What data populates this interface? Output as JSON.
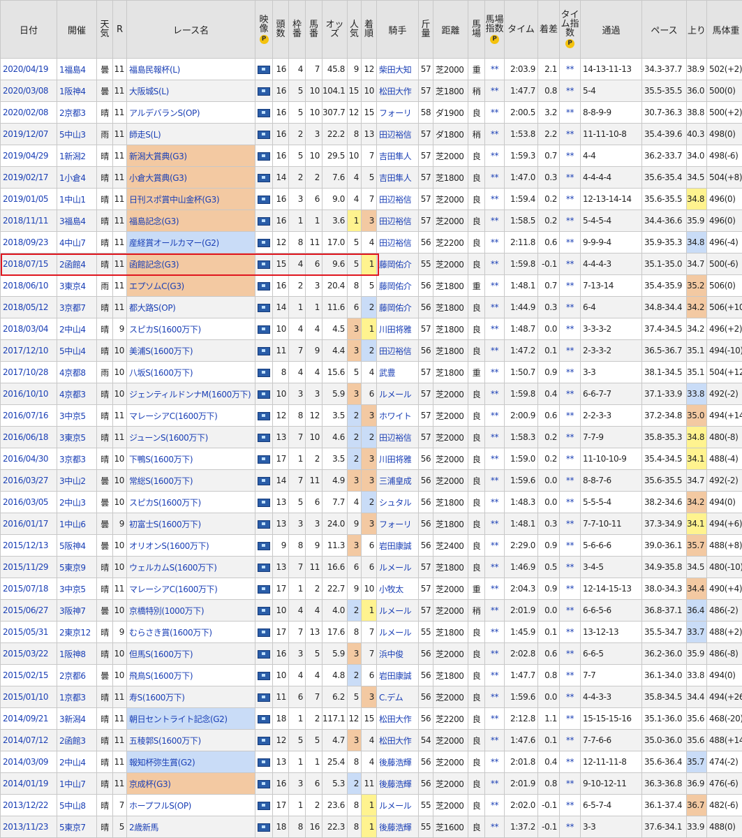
{
  "headers": {
    "date": "日付",
    "kaisai": "開催",
    "weather": "天気",
    "r": "R",
    "race_name": "レース名",
    "video": "映像",
    "heads": "頭数",
    "waku": "枠番",
    "uma": "馬番",
    "odds": "オッズ",
    "ninki": "人気",
    "chakujun": "着順",
    "jockey": "騎手",
    "kinryo": "斤量",
    "distance": "距離",
    "baba": "馬場",
    "baba_index": "馬場指数",
    "time": "タイム",
    "chakusa": "着差",
    "time_index": "タイム指数",
    "tsuka": "通過",
    "pace": "ペース",
    "agari": "上り",
    "weight": "馬体重",
    "p_badge": "P"
  },
  "colors": {
    "g3": "#f3c9a2",
    "g2": "#c9dcf7",
    "pick1": "#fff38f",
    "link": "#1a3fb5",
    "highlight": "#e0161f"
  },
  "rows": [
    [
      "2020/04/19",
      "1福島4",
      "曇",
      "11",
      "福島民報杯(L)",
      "",
      "16",
      "4",
      "7",
      "45.8",
      "9",
      "12",
      "柴田大知",
      "57",
      "芝2000",
      "重",
      "**",
      "2:03.9",
      "2.1",
      "**",
      "14-13-11-13",
      "34.3-37.7",
      "38.9",
      "502(+2)"
    ],
    [
      "2020/03/08",
      "1阪神4",
      "曇",
      "11",
      "大阪城S(L)",
      "",
      "16",
      "5",
      "10",
      "104.1",
      "15",
      "10",
      "松田大作",
      "57",
      "芝1800",
      "稍",
      "**",
      "1:47.7",
      "0.8",
      "**",
      "5-4",
      "35.5-35.5",
      "36.0",
      "500(0)"
    ],
    [
      "2020/02/08",
      "2京都3",
      "晴",
      "11",
      "アルデバランS(OP)",
      "",
      "16",
      "5",
      "10",
      "307.7",
      "12",
      "15",
      "フォーリ",
      "58",
      "ダ1900",
      "良",
      "**",
      "2:00.5",
      "3.2",
      "**",
      "8-8-9-9",
      "30.7-36.3",
      "38.8",
      "500(+2)"
    ],
    [
      "2019/12/07",
      "5中山3",
      "雨",
      "11",
      "師走S(L)",
      "",
      "16",
      "2",
      "3",
      "22.2",
      "8",
      "13",
      "田辺裕信",
      "57",
      "ダ1800",
      "稍",
      "**",
      "1:53.8",
      "2.2",
      "**",
      "11-11-10-8",
      "35.4-39.6",
      "40.3",
      "498(0)"
    ],
    [
      "2019/04/29",
      "1新潟2",
      "晴",
      "11",
      "新潟大賞典(G3)",
      "g3",
      "16",
      "5",
      "10",
      "29.5",
      "10",
      "7",
      "吉田隼人",
      "57",
      "芝2000",
      "良",
      "**",
      "1:59.3",
      "0.7",
      "**",
      "4-4",
      "36.2-33.7",
      "34.0",
      "498(-6)"
    ],
    [
      "2019/02/17",
      "1小倉4",
      "晴",
      "11",
      "小倉大賞典(G3)",
      "g3",
      "14",
      "2",
      "2",
      "7.6",
      "4",
      "5",
      "吉田隼人",
      "57",
      "芝1800",
      "良",
      "**",
      "1:47.0",
      "0.3",
      "**",
      "4-4-4-4",
      "35.6-35.4",
      "34.5",
      "504(+8)"
    ],
    [
      "2019/01/05",
      "1中山1",
      "晴",
      "11",
      "日刊スポ賞中山金杯(G3)",
      "g3",
      "16",
      "3",
      "6",
      "9.0",
      "4",
      "7",
      "田辺裕信",
      "57",
      "芝2000",
      "良",
      "**",
      "1:59.4",
      "0.2",
      "**",
      "12-13-14-14",
      "35.6-35.5",
      "34.8",
      "496(0)"
    ],
    [
      "2018/11/11",
      "3福島4",
      "晴",
      "11",
      "福島記念(G3)",
      "g3",
      "16",
      "1",
      "1",
      "3.6",
      "1",
      "3",
      "田辺裕信",
      "57",
      "芝2000",
      "良",
      "**",
      "1:58.5",
      "0.2",
      "**",
      "5-4-5-4",
      "34.4-36.6",
      "35.9",
      "496(0)"
    ],
    [
      "2018/09/23",
      "4中山7",
      "晴",
      "11",
      "産経賞オールカマー(G2)",
      "g2",
      "12",
      "8",
      "11",
      "17.0",
      "5",
      "4",
      "田辺裕信",
      "56",
      "芝2200",
      "良",
      "**",
      "2:11.8",
      "0.6",
      "**",
      "9-9-9-4",
      "35.9-35.3",
      "34.8",
      "496(-4)"
    ],
    [
      "2018/07/15",
      "2函館4",
      "晴",
      "11",
      "函館記念(G3)",
      "g3",
      "15",
      "4",
      "6",
      "9.6",
      "5",
      "1",
      "藤岡佑介",
      "55",
      "芝2000",
      "良",
      "**",
      "1:59.8",
      "-0.1",
      "**",
      "4-4-4-3",
      "35.1-35.0",
      "34.7",
      "500(-6)"
    ],
    [
      "2018/06/10",
      "3東京4",
      "雨",
      "11",
      "エプソムC(G3)",
      "g3",
      "16",
      "2",
      "3",
      "20.4",
      "8",
      "5",
      "藤岡佑介",
      "56",
      "芝1800",
      "重",
      "**",
      "1:48.1",
      "0.7",
      "**",
      "7-13-14",
      "35.4-35.9",
      "35.2",
      "506(0)"
    ],
    [
      "2018/05/12",
      "3京都7",
      "晴",
      "11",
      "都大路S(OP)",
      "",
      "14",
      "1",
      "1",
      "11.6",
      "6",
      "2",
      "藤岡佑介",
      "56",
      "芝1800",
      "良",
      "**",
      "1:44.9",
      "0.3",
      "**",
      "6-4",
      "34.8-34.4",
      "34.2",
      "506(+10)"
    ],
    [
      "2018/03/04",
      "2中山4",
      "晴",
      "9",
      "スピカS(1600万下)",
      "",
      "10",
      "4",
      "4",
      "4.5",
      "3",
      "1",
      "川田将雅",
      "57",
      "芝1800",
      "良",
      "**",
      "1:48.7",
      "0.0",
      "**",
      "3-3-3-2",
      "37.4-34.5",
      "34.2",
      "496(+2)"
    ],
    [
      "2017/12/10",
      "5中山4",
      "晴",
      "10",
      "美浦S(1600万下)",
      "",
      "11",
      "7",
      "9",
      "4.4",
      "3",
      "2",
      "田辺裕信",
      "56",
      "芝1800",
      "良",
      "**",
      "1:47.2",
      "0.1",
      "**",
      "2-3-3-2",
      "36.5-36.7",
      "35.1",
      "494(-10)"
    ],
    [
      "2017/10/28",
      "4京都8",
      "雨",
      "10",
      "八坂S(1600万下)",
      "",
      "8",
      "4",
      "4",
      "15.6",
      "5",
      "4",
      "武豊",
      "57",
      "芝1800",
      "重",
      "**",
      "1:50.7",
      "0.9",
      "**",
      "3-3",
      "38.1-34.5",
      "35.1",
      "504(+12)"
    ],
    [
      "2016/10/10",
      "4京都3",
      "晴",
      "10",
      "ジェンティルドンナM(1600万下)",
      "",
      "10",
      "3",
      "3",
      "5.9",
      "3",
      "6",
      "ルメール",
      "57",
      "芝2000",
      "良",
      "**",
      "1:59.8",
      "0.4",
      "**",
      "6-6-7-7",
      "37.1-33.9",
      "33.8",
      "492(-2)"
    ],
    [
      "2016/07/16",
      "3中京5",
      "晴",
      "11",
      "マレーシアC(1600万下)",
      "",
      "12",
      "8",
      "12",
      "3.5",
      "2",
      "3",
      "ホワイト",
      "57",
      "芝2000",
      "良",
      "**",
      "2:00.9",
      "0.6",
      "**",
      "2-2-3-3",
      "37.2-34.8",
      "35.0",
      "494(+14)"
    ],
    [
      "2016/06/18",
      "3東京5",
      "晴",
      "11",
      "ジューンS(1600万下)",
      "",
      "13",
      "7",
      "10",
      "4.6",
      "2",
      "2",
      "田辺裕信",
      "57",
      "芝2000",
      "良",
      "**",
      "1:58.3",
      "0.2",
      "**",
      "7-7-9",
      "35.8-35.3",
      "34.8",
      "480(-8)"
    ],
    [
      "2016/04/30",
      "3京都3",
      "晴",
      "10",
      "下鴨S(1600万下)",
      "",
      "17",
      "1",
      "2",
      "3.5",
      "2",
      "3",
      "川田将雅",
      "56",
      "芝2000",
      "良",
      "**",
      "1:59.0",
      "0.2",
      "**",
      "11-10-10-9",
      "35.4-34.5",
      "34.1",
      "488(-4)"
    ],
    [
      "2016/03/27",
      "3中山2",
      "曇",
      "10",
      "常総S(1600万下)",
      "",
      "14",
      "7",
      "11",
      "4.9",
      "3",
      "3",
      "三浦皇成",
      "56",
      "芝2000",
      "良",
      "**",
      "1:59.6",
      "0.0",
      "**",
      "8-8-7-6",
      "35.6-35.5",
      "34.7",
      "492(-2)"
    ],
    [
      "2016/03/05",
      "2中山3",
      "曇",
      "10",
      "スピカS(1600万下)",
      "",
      "13",
      "5",
      "6",
      "7.7",
      "4",
      "2",
      "シュタル",
      "56",
      "芝1800",
      "良",
      "**",
      "1:48.3",
      "0.0",
      "**",
      "5-5-5-4",
      "38.2-34.6",
      "34.2",
      "494(0)"
    ],
    [
      "2016/01/17",
      "1中山6",
      "曇",
      "9",
      "初富士S(1600万下)",
      "",
      "13",
      "3",
      "24.0",
      "9",
      "3",
      "",
      "フォーリ",
      "56",
      "芝1800",
      "良",
      "**",
      "1:48.1",
      "0.3",
      "**",
      "7-7-10-11",
      "37.3-34.9",
      "34.1",
      "494(+6)"
    ],
    [
      "2015/12/13",
      "5阪神4",
      "曇",
      "10",
      "オリオンS(1600万下)",
      "",
      "9",
      "8",
      "9",
      "11.3",
      "3",
      "6",
      "岩田康誠",
      "56",
      "芝2400",
      "良",
      "**",
      "2:29.0",
      "0.9",
      "**",
      "5-6-6-6",
      "39.0-36.1",
      "35.7",
      "488(+8)"
    ],
    [
      "2015/11/29",
      "5東京9",
      "晴",
      "10",
      "ウェルカムS(1600万下)",
      "",
      "13",
      "7",
      "11",
      "16.6",
      "6",
      "6",
      "ルメール",
      "57",
      "芝1800",
      "良",
      "**",
      "1:46.9",
      "0.5",
      "**",
      "3-4-5",
      "34.9-35.8",
      "34.5",
      "480(-10)"
    ],
    [
      "2015/07/18",
      "3中京5",
      "晴",
      "11",
      "マレーシアC(1600万下)",
      "",
      "17",
      "1",
      "2",
      "22.7",
      "9",
      "10",
      "小牧太",
      "57",
      "芝2000",
      "重",
      "**",
      "2:04.3",
      "0.9",
      "**",
      "12-14-15-13",
      "38.0-34.3",
      "34.4",
      "490(+4)"
    ],
    [
      "2015/06/27",
      "3阪神7",
      "曇",
      "10",
      "京橋特別(1000万下)",
      "",
      "10",
      "4",
      "4",
      "4.0",
      "2",
      "1",
      "ルメール",
      "57",
      "芝2000",
      "稍",
      "**",
      "2:01.9",
      "0.0",
      "**",
      "6-6-5-6",
      "36.8-37.1",
      "36.4",
      "486(-2)"
    ],
    [
      "2015/05/31",
      "2東京12",
      "晴",
      "9",
      "むらさき賞(1600万下)",
      "",
      "17",
      "7",
      "13",
      "17.6",
      "8",
      "7",
      "ルメール",
      "55",
      "芝1800",
      "良",
      "**",
      "1:45.9",
      "0.1",
      "**",
      "13-12-13",
      "35.5-34.7",
      "33.7",
      "488(+2)"
    ],
    [
      "2015/03/22",
      "1阪神8",
      "晴",
      "10",
      "但馬S(1600万下)",
      "",
      "16",
      "3",
      "5",
      "5.9",
      "3",
      "7",
      "浜中俊",
      "56",
      "芝2000",
      "良",
      "**",
      "2:02.8",
      "0.6",
      "**",
      "6-6-5",
      "36.2-36.0",
      "35.9",
      "486(-8)"
    ],
    [
      "2015/02/15",
      "2京都6",
      "曇",
      "10",
      "飛鳥S(1600万下)",
      "",
      "10",
      "4",
      "4",
      "4.8",
      "2",
      "6",
      "岩田康誠",
      "56",
      "芝1800",
      "良",
      "**",
      "1:47.7",
      "0.8",
      "**",
      "7-7",
      "36.1-34.0",
      "33.8",
      "494(0)"
    ],
    [
      "2015/01/10",
      "1京都3",
      "晴",
      "11",
      "寿S(1600万下)",
      "",
      "11",
      "6",
      "7",
      "6.2",
      "5",
      "3",
      "C.デム",
      "56",
      "芝2000",
      "良",
      "**",
      "1:59.6",
      "0.0",
      "**",
      "4-4-3-3",
      "35.8-34.5",
      "34.4",
      "494(+26)"
    ],
    [
      "2014/09/21",
      "3新潟4",
      "晴",
      "11",
      "朝日セントライト記念(G2)",
      "g2",
      "18",
      "1",
      "2",
      "117.1",
      "12",
      "15",
      "松田大作",
      "56",
      "芝2200",
      "良",
      "**",
      "2:12.8",
      "1.1",
      "**",
      "15-15-15-16",
      "35.1-36.0",
      "35.6",
      "468(-20)"
    ],
    [
      "2014/07/12",
      "2函館3",
      "晴",
      "11",
      "五稜郭S(1600万下)",
      "",
      "12",
      "5",
      "5",
      "4.7",
      "3",
      "4",
      "松田大作",
      "54",
      "芝2000",
      "良",
      "**",
      "1:47.6",
      "0.1",
      "**",
      "7-7-6-6",
      "35.0-36.0",
      "35.6",
      "488(+14)"
    ],
    [
      "2014/03/09",
      "2中山4",
      "晴",
      "11",
      "報知杯弥生賞(G2)",
      "g2",
      "13",
      "1",
      "1",
      "25.4",
      "8",
      "4",
      "後藤浩輝",
      "56",
      "芝2000",
      "良",
      "**",
      "2:01.8",
      "0.4",
      "**",
      "12-11-11-8",
      "35.6-36.4",
      "35.7",
      "474(-2)"
    ],
    [
      "2014/01/19",
      "1中山7",
      "晴",
      "11",
      "京成杯(G3)",
      "g3",
      "16",
      "3",
      "6",
      "5.3",
      "2",
      "11",
      "後藤浩輝",
      "56",
      "芝2000",
      "良",
      "**",
      "2:01.9",
      "0.8",
      "**",
      "9-10-12-11",
      "36.3-36.8",
      "36.9",
      "476(-6)"
    ],
    [
      "2013/12/22",
      "5中山8",
      "晴",
      "7",
      "ホープフルS(OP)",
      "",
      "17",
      "1",
      "2",
      "23.6",
      "8",
      "1",
      "ルメール",
      "55",
      "芝2000",
      "良",
      "**",
      "2:02.0",
      "-0.1",
      "**",
      "6-5-7-4",
      "36.1-37.4",
      "36.7",
      "482(-6)"
    ],
    [
      "2013/11/23",
      "5東京7",
      "晴",
      "5",
      "2歳新馬",
      "",
      "18",
      "8",
      "16",
      "22.3",
      "8",
      "1",
      "後藤浩輝",
      "55",
      "芝1600",
      "良",
      "**",
      "1:37.2",
      "-0.1",
      "**",
      "3-3",
      "37.6-34.1",
      "33.9",
      "488(0)"
    ]
  ]
}
